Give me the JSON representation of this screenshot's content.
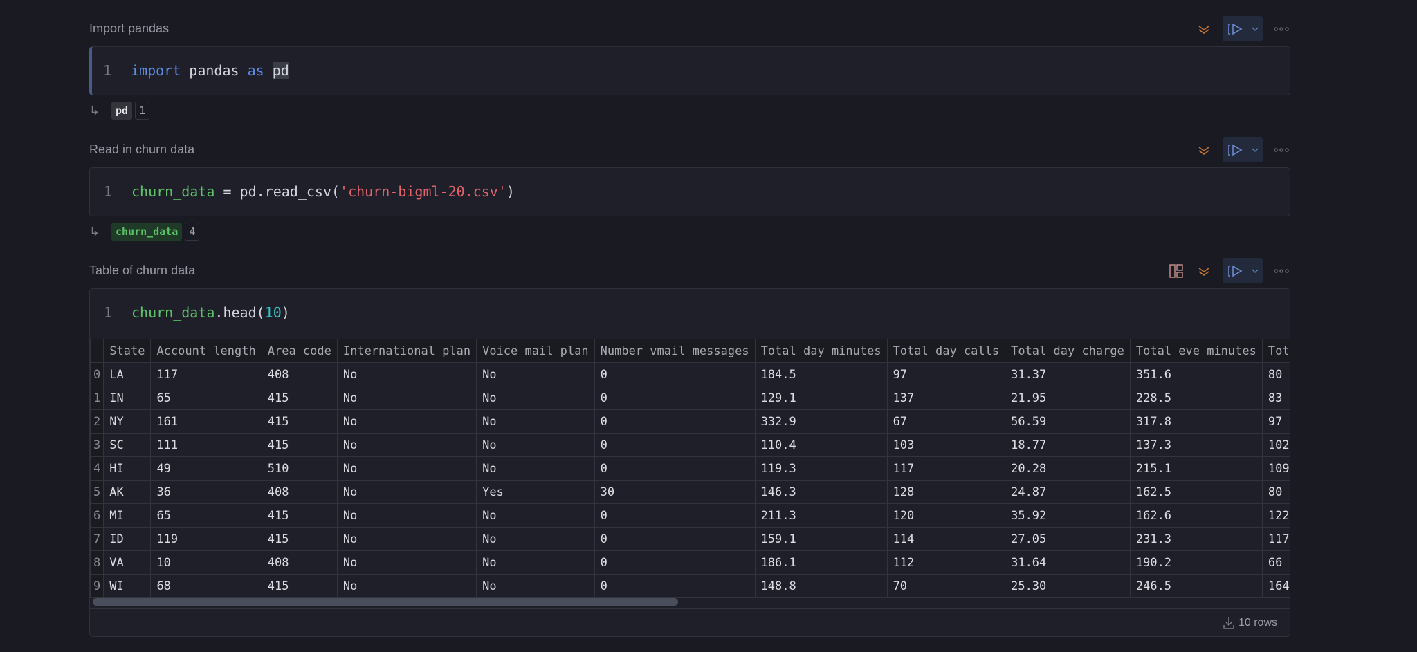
{
  "cells": [
    {
      "title": "Import pandas",
      "line": "1",
      "code": {
        "kw1": "import",
        "mod": "pandas",
        "kw2": "as",
        "alias": "pd"
      },
      "output": {
        "name": "pd",
        "count": "1"
      }
    },
    {
      "title": "Read in churn data",
      "line": "1",
      "code": {
        "var": "churn_data",
        "op": " = ",
        "call": "pd.read_csv(",
        "str": "'churn-bigml-20.csv'",
        "close": ")"
      },
      "output": {
        "name": "churn_data",
        "count": "4"
      }
    },
    {
      "title": "Table of churn data",
      "line": "1",
      "code": {
        "var": "churn_data",
        "call": ".head(",
        "num": "10",
        "close": ")"
      },
      "table": {
        "columns": [
          "",
          "State",
          "Account length",
          "Area code",
          "International plan",
          "Voice mail plan",
          "Number vmail messages",
          "Total day minutes",
          "Total day calls",
          "Total day charge",
          "Total eve minutes",
          "Total eve calls"
        ],
        "rows": [
          [
            "0",
            "LA",
            "117",
            "408",
            "No",
            "No",
            "0",
            "184.5",
            "97",
            "31.37",
            "351.6",
            "80"
          ],
          [
            "1",
            "IN",
            "65",
            "415",
            "No",
            "No",
            "0",
            "129.1",
            "137",
            "21.95",
            "228.5",
            "83"
          ],
          [
            "2",
            "NY",
            "161",
            "415",
            "No",
            "No",
            "0",
            "332.9",
            "67",
            "56.59",
            "317.8",
            "97"
          ],
          [
            "3",
            "SC",
            "111",
            "415",
            "No",
            "No",
            "0",
            "110.4",
            "103",
            "18.77",
            "137.3",
            "102"
          ],
          [
            "4",
            "HI",
            "49",
            "510",
            "No",
            "No",
            "0",
            "119.3",
            "117",
            "20.28",
            "215.1",
            "109"
          ],
          [
            "5",
            "AK",
            "36",
            "408",
            "No",
            "Yes",
            "30",
            "146.3",
            "128",
            "24.87",
            "162.5",
            "80"
          ],
          [
            "6",
            "MI",
            "65",
            "415",
            "No",
            "No",
            "0",
            "211.3",
            "120",
            "35.92",
            "162.6",
            "122"
          ],
          [
            "7",
            "ID",
            "119",
            "415",
            "No",
            "No",
            "0",
            "159.1",
            "114",
            "27.05",
            "231.3",
            "117"
          ],
          [
            "8",
            "VA",
            "10",
            "408",
            "No",
            "No",
            "0",
            "186.1",
            "112",
            "31.64",
            "190.2",
            "66"
          ],
          [
            "9",
            "WI",
            "68",
            "415",
            "No",
            "No",
            "0",
            "148.8",
            "70",
            "25.30",
            "246.5",
            "164"
          ]
        ],
        "row_count": "10 rows"
      }
    }
  ],
  "icons": {
    "reactive": "reactive-chevrons-icon",
    "run": "run-cell-icon",
    "dropdown": "chevron-down-icon",
    "more": "more-icon",
    "layout": "layout-icon",
    "download": "download-icon"
  },
  "colors": {
    "accent": "#5b8fe8",
    "variable": "#5ec46a",
    "string": "#e0646a",
    "reactive": "#c8783a"
  }
}
